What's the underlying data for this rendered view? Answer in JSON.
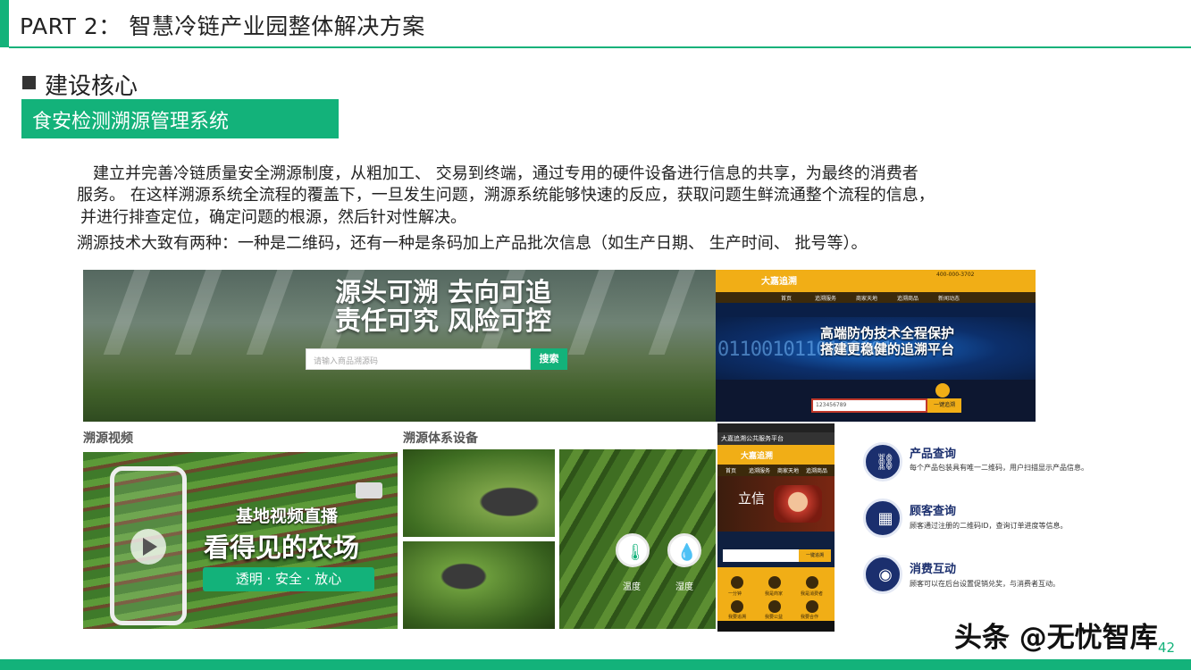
{
  "header": {
    "title": "PART 2： 智慧冷链产业园整体解决方案"
  },
  "section": {
    "title": "建设核心",
    "subtitle": "食安检测溯源管理系统"
  },
  "paragraphs": {
    "p1_line1": "建立并完善冷链质量安全溯源制度，从粗加工、 交易到终端，通过专用的硬件设备进行信息的共享，为最终的消费者",
    "p1_line2": "服务。 在这样溯源系统全流程的覆盖下，一旦发生问题，溯源系统能够快速的反应，获取问题生鲜流通整个流程的信息，",
    "p1_line3": "并进行排查定位，确定问题的根源，然后针对性解决。",
    "p2": "溯源技术大致有两种：一种是二维码，还有一种是条码加上产品批次信息（如生产日期、 生产时间、 批号等）。"
  },
  "banner": {
    "line1": "源头可溯 去向可追",
    "line2": "责任可究 风险可控",
    "search_placeholder": "请输入商品溯源码",
    "search_button": "搜索"
  },
  "website": {
    "logo": "大嘉追溯",
    "phone": "400-000-3702",
    "nav": [
      "首页",
      "追溯服务",
      "商家天地",
      "追溯商品",
      "新闻动态"
    ],
    "binary": "0110010110100101",
    "headline1": "高端防伪技术全程保护",
    "headline2": "搭建更稳健的追溯平台",
    "input_value": "123456789",
    "button": "一键追溯"
  },
  "labels": {
    "video": "溯源视频",
    "equipment": "溯源体系设备"
  },
  "video": {
    "line1": "基地视频直播",
    "line2": "看得见的农场",
    "tagline": "透明 · 安全 · 放心"
  },
  "sensors": {
    "temp": "温度",
    "humidity": "湿度"
  },
  "mobile": {
    "status": "大嘉追溯公共服务平台",
    "logo": "大嘉追溯",
    "nav": [
      "首页",
      "追溯服务",
      "商家天地",
      "追溯商品"
    ],
    "hero": "立信",
    "button": "一键追溯",
    "grid": [
      "一分钟",
      "我是商家",
      "我是消费者",
      "我要追溯",
      "我要公益",
      "我要合作"
    ]
  },
  "features": [
    {
      "title": "产品查询",
      "desc": "每个产品包装具有唯一二维码，用户扫描显示产品信息。",
      "icon": "qr-link-icon"
    },
    {
      "title": "顾客查询",
      "desc": "顾客通过注册的二维码ID，查询订单进度等信息。",
      "icon": "calendar-icon"
    },
    {
      "title": "消费互动",
      "desc": "顾客可以在后台设置促销兑奖，与消费者互动。",
      "icon": "eye-icon"
    }
  ],
  "watermark": "头条 @无忧智库",
  "page_number": "42",
  "colors": {
    "accent": "#13b27a",
    "navy": "#1b2f6e",
    "gold": "#f1ae16"
  }
}
